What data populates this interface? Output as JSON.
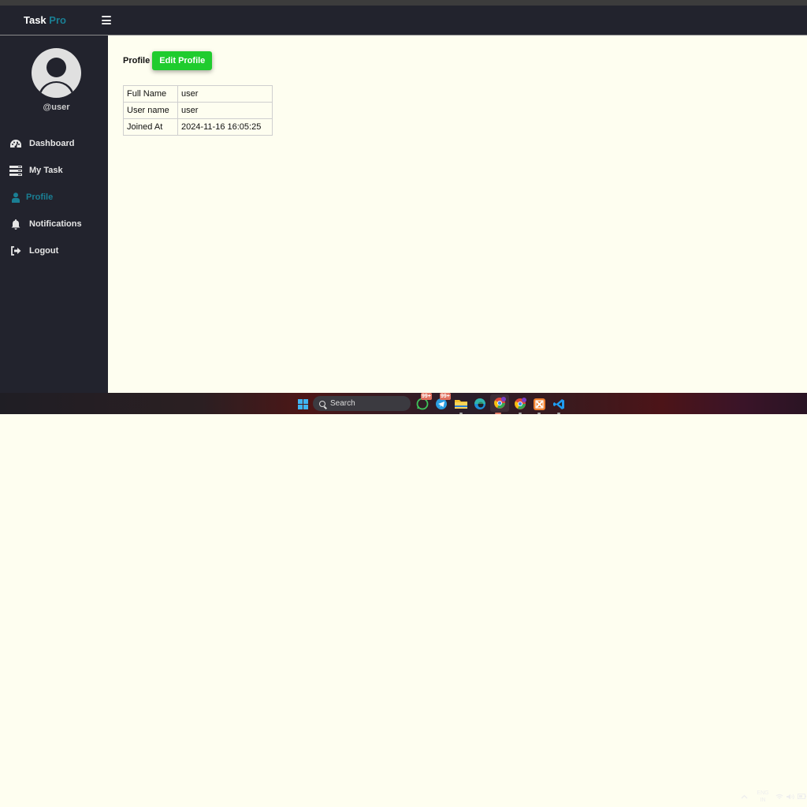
{
  "app": {
    "brand_main": "Task",
    "brand_accent": "Pro",
    "accent_color": "#1a7f94"
  },
  "sidebar": {
    "username": "@user",
    "items": [
      {
        "label": "Dashboard",
        "icon": "tachometer-icon",
        "active": false
      },
      {
        "label": "My Task",
        "icon": "tasks-icon",
        "active": false
      },
      {
        "label": "Profile",
        "icon": "user-icon",
        "active": true
      },
      {
        "label": "Notifications",
        "icon": "bell-icon",
        "active": false
      },
      {
        "label": "Logout",
        "icon": "sign-out-icon",
        "active": false
      }
    ]
  },
  "main": {
    "title": "Profile",
    "edit_button": "Edit Profile",
    "edit_button_color": "#1fcc2e",
    "rows": [
      {
        "key": "Full Name",
        "value": "user"
      },
      {
        "key": "User name",
        "value": "user"
      },
      {
        "key": "Joined At",
        "value": "2024-11-16 16:05:25"
      }
    ]
  },
  "taskbar": {
    "search_placeholder": "Search",
    "whatsapp_badge": "99+",
    "telegram_badge": "99+",
    "language": "ENG",
    "region": "IN"
  }
}
